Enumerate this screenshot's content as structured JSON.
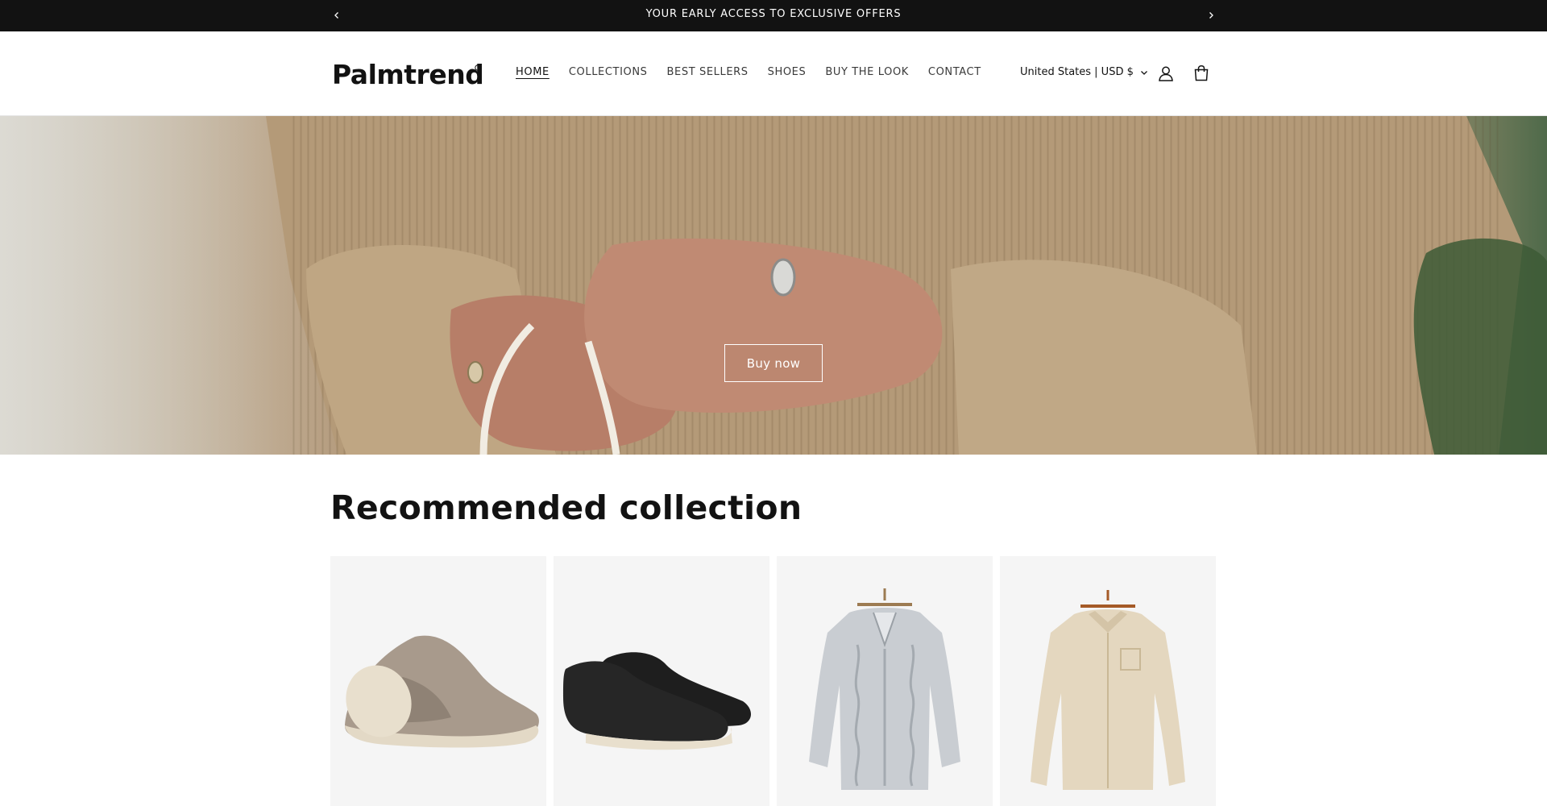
{
  "announcement": {
    "text": "YOUR EARLY ACCESS TO EXCLUSIVE OFFERS",
    "prev_icon": "chevron-left-icon",
    "next_icon": "chevron-right-icon"
  },
  "header": {
    "logo_text": "Palmtrend",
    "nav": [
      {
        "label": "HOME",
        "active": true
      },
      {
        "label": "COLLECTIONS"
      },
      {
        "label": "BEST SELLERS"
      },
      {
        "label": "SHOES"
      },
      {
        "label": "BUY THE LOOK"
      },
      {
        "label": "CONTACT"
      }
    ],
    "country_selector": "United States | USD $",
    "account_icon": "user-icon",
    "cart_icon": "shopping-bag-icon"
  },
  "hero": {
    "cta_label": "Buy now"
  },
  "collection": {
    "title": "Recommended collection",
    "products": [
      {
        "name": "taupe-suede-loafer",
        "color": "#a89a8c"
      },
      {
        "name": "black-suede-chukka",
        "color": "#1e1e1e"
      },
      {
        "name": "grey-cable-knit-sweater",
        "color": "#c9cdd2"
      },
      {
        "name": "beige-linen-shirt",
        "color": "#e4d7bf"
      }
    ]
  },
  "colors": {
    "announcement_bg": "#121212",
    "text": "#121212",
    "card_bg": "#f5f5f5"
  }
}
